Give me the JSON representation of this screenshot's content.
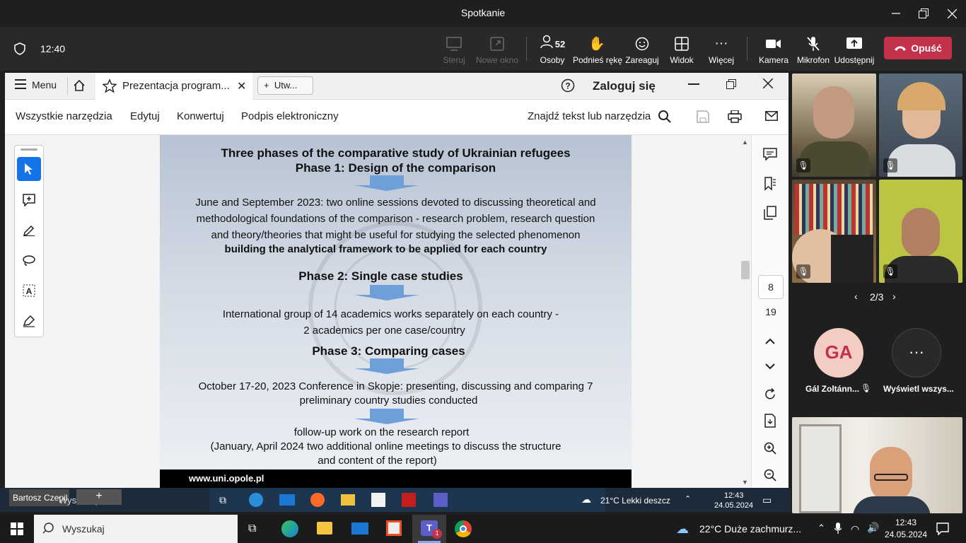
{
  "window": {
    "title": "Spotkanie"
  },
  "meeting": {
    "time": "12:40",
    "steer_label": "Steruj",
    "new_window_label": "Nowe okno",
    "people_count": "52",
    "people_label": "Osoby",
    "raise_hand_label": "Podnieś rękę",
    "react_label": "Zareaguj",
    "view_label": "Widok",
    "more_label": "Więcej",
    "camera_label": "Kamera",
    "mic_label": "Mikrofon",
    "share_label": "Udostępnij",
    "leave_label": "Opuść"
  },
  "acrobat": {
    "menu_label": "Menu",
    "tab_title": "Prezentacja program...",
    "new_tab_label": "Utw...",
    "sign_in": "Zaloguj się",
    "tools": [
      "Wszystkie narzędzia",
      "Edytuj",
      "Konwertuj",
      "Podpis elektroniczny"
    ],
    "search_placeholder": "Znajdź tekst lub narzędzia",
    "page_current": "8",
    "page_total": "19"
  },
  "slide": {
    "title1": "Three phases of the  comparative study of Ukrainian refugees",
    "title2": "Phase 1: Design of the comparison",
    "p1_line1": "June and September 2023:  two online sessions devoted to discussing theoretical and",
    "p1_line2": "methodological foundations of the comparison - research problem, research question",
    "p1_line3": "and theory/theories that might be useful for studying the selected phenomenon",
    "p1_bold": "building the analytical framework to be applied for each country",
    "phase2": "Phase 2: Single case studies",
    "p2_line1": "International group of 14 academics  works separately on each country  -",
    "p2_line2": "2 academics per one case/country",
    "phase3": "Phase 3: Comparing cases",
    "p3_line1": "October 17-20, 2023 Conference in Skopje: presenting, discussing and comparing  7",
    "p3_line2": "preliminary country studies conducted",
    "p4_line1": "follow-up work on the research report",
    "p4_line2": "(January, April 2024 two additional online meetings to discuss the structure",
    "p4_line3": "and content of the  report)",
    "footer_url": "www.uni.opole.pl"
  },
  "participants": {
    "pager": "2/3",
    "initials": "GA",
    "initials_name": "Gál Zoltánn...",
    "show_all_label": "Wyświetl wszys...",
    "presenter_name": "Bartosz Czepil"
  },
  "inner_taskbar": {
    "search": "Wyszukaj",
    "weather": "21°C  Lekki deszcz",
    "time": "12:43",
    "date": "24.05.2024"
  },
  "taskbar": {
    "search": "Wyszukaj",
    "weather": "22°C  Duże zachmurz...",
    "time": "12:43",
    "date": "24.05.2024",
    "teams_badge": "1"
  },
  "colors": {
    "leave": "#c4314b",
    "arrow": "#6f9fd8",
    "acrobat_blue": "#1473e6"
  }
}
